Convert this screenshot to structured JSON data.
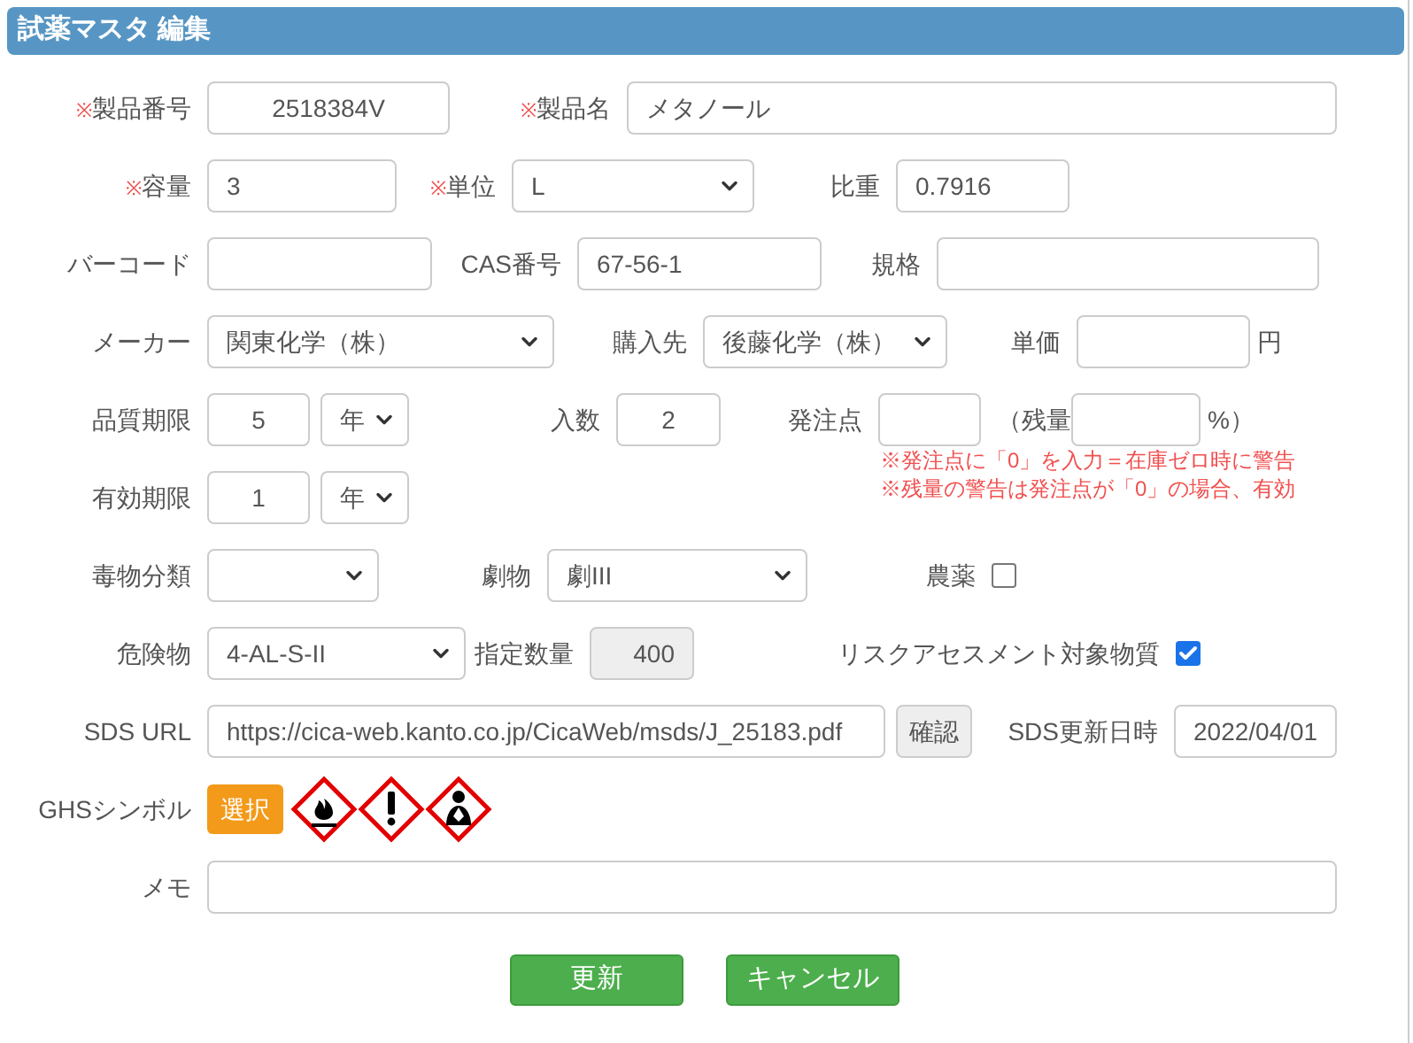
{
  "title": "試薬マスタ 編集",
  "required_mark": "※",
  "product_no": {
    "label": "製品番号",
    "required": true,
    "value": "2518384V"
  },
  "product_name": {
    "label": "製品名",
    "required": true,
    "value": "メタノール"
  },
  "volume": {
    "label": "容量",
    "required": true,
    "value": "3"
  },
  "unit": {
    "label": "単位",
    "required": true,
    "value": "L"
  },
  "specific_gravity": {
    "label": "比重",
    "value": "0.7916"
  },
  "barcode": {
    "label": "バーコード"
  },
  "cas_no": {
    "label": "CAS番号",
    "value": "67-56-1"
  },
  "standard": {
    "label": "規格"
  },
  "maker": {
    "label": "メーカー",
    "value": "関東化学（株）"
  },
  "supplier": {
    "label": "購入先",
    "value": "後藤化学（株）"
  },
  "unit_price": {
    "label": "単価",
    "suffix": "円"
  },
  "quality_period": {
    "label": "品質期限",
    "value": "5",
    "unit": "年"
  },
  "quantity": {
    "label": "入数",
    "value": "2"
  },
  "reorder_point": {
    "label": "発注点"
  },
  "remaining": {
    "label": "（残量",
    "suffix": "%）"
  },
  "notes": [
    "※発注点に「0」を入力＝在庫ゼロ時に警告",
    "※残量の警告は発注点が「0」の場合、有効"
  ],
  "expiry_period": {
    "label": "有効期限",
    "value": "1",
    "unit": "年"
  },
  "poison_class": {
    "label": "毒物分類"
  },
  "deleterious": {
    "label": "劇物",
    "value": "劇III"
  },
  "pesticide": {
    "label": "農薬",
    "checked": false
  },
  "hazardous": {
    "label": "危険物",
    "value": "4-AL-S-II"
  },
  "designated_qty": {
    "label": "指定数量",
    "value": "400"
  },
  "risk_assessment": {
    "label": "リスクアセスメント対象物質",
    "checked": true
  },
  "sds_url": {
    "label": "SDS URL",
    "value": "https://cica-web.kanto.co.jp/CicaWeb/msds/J_25183.pdf",
    "button": "確認"
  },
  "sds_date": {
    "label": "SDS更新日時",
    "value": "2022/04/01"
  },
  "ghs": {
    "label": "GHSシンボル",
    "button": "選択",
    "symbols": [
      {
        "kind": "flame"
      },
      {
        "kind": "exclamation"
      },
      {
        "kind": "health"
      }
    ]
  },
  "memo": {
    "label": "メモ"
  },
  "buttons": [
    "更新",
    "キャンセル"
  ]
}
